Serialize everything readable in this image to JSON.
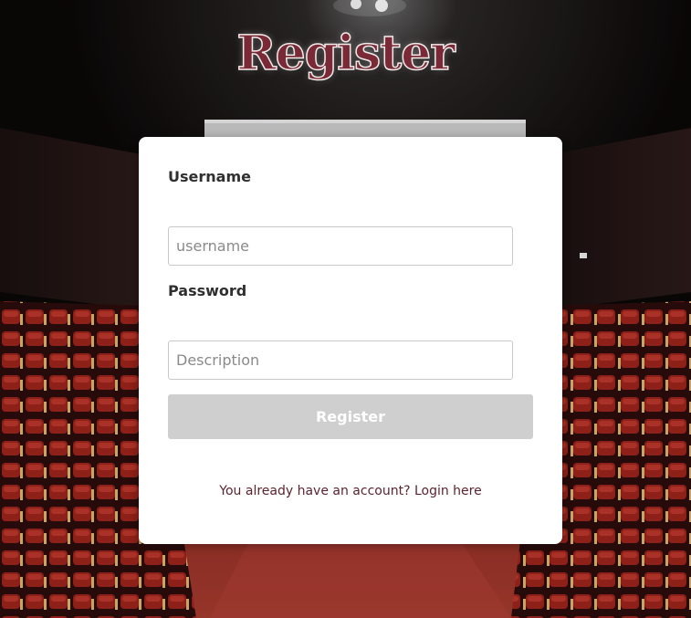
{
  "page": {
    "title": "Register"
  },
  "form": {
    "username_label": "Username",
    "username_placeholder": "username",
    "username_value": "",
    "password_label": "Password",
    "password_placeholder": "Description",
    "password_value": "",
    "submit_label": "Register",
    "login_link_text": "You already have an account? Login here"
  },
  "colors": {
    "title": "#7a2a36",
    "button_bg": "#cfcfcf",
    "link": "#5b2430",
    "theater_seat": "#8e1f1a"
  }
}
